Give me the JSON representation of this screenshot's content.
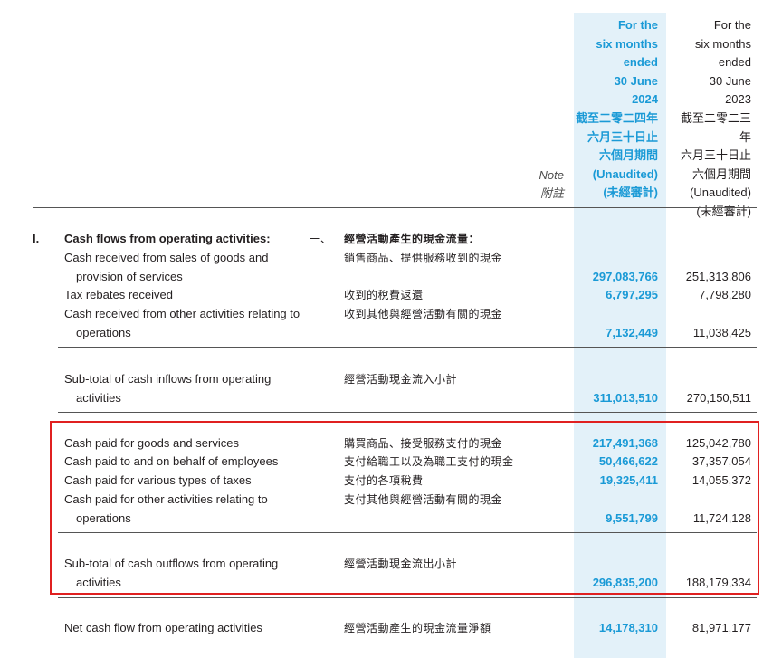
{
  "header": {
    "current_lines": [
      "For the",
      "six months",
      "ended",
      "30 June",
      "2024",
      "截至二零二四年",
      "六月三十日止",
      "六個月期間",
      "(Unaudited)",
      "(未經審計)"
    ],
    "previous_lines": [
      "For the",
      "six months",
      "ended",
      "30 June",
      "2023",
      "截至二零二三年",
      "六月三十日止",
      "六個月期間",
      "(Unaudited)",
      "(未經審計)"
    ],
    "note_en": "Note",
    "note_zh": "附註"
  },
  "section": {
    "number": "I.",
    "title_en": "Cash flows from operating activities:",
    "title_zh_prefix": "一、",
    "title_zh": "經營活動產生的現金流量："
  },
  "rows": {
    "sales": {
      "en1": "Cash received from sales of goods and",
      "en2": "provision of services",
      "zh": "銷售商品、提供服務收到的現金",
      "cur": "297,083,766",
      "prev": "251,313,806"
    },
    "tax_rebates": {
      "en1": "Tax rebates received",
      "zh": "收到的稅費返還",
      "cur": "6,797,295",
      "prev": "7,798,280"
    },
    "other_in": {
      "en1": "Cash received from other activities relating to",
      "en2": "operations",
      "zh": "收到其他與經營活動有關的現金",
      "cur": "7,132,449",
      "prev": "11,038,425"
    },
    "subtotal_in": {
      "en1": "Sub-total of cash inflows from operating",
      "en2": "activities",
      "zh": "經營活動現金流入小計",
      "cur": "311,013,510",
      "prev": "270,150,511"
    },
    "goods": {
      "en1": "Cash paid for goods and services",
      "zh": "購買商品、接受服務支付的現金",
      "cur": "217,491,368",
      "prev": "125,042,780"
    },
    "employees": {
      "en1": "Cash paid to and on behalf of employees",
      "zh": "支付給職工以及為職工支付的現金",
      "cur": "50,466,622",
      "prev": "37,357,054"
    },
    "taxes": {
      "en1": "Cash paid for various types of taxes",
      "zh": "支付的各項稅費",
      "cur": "19,325,411",
      "prev": "14,055,372"
    },
    "other_out": {
      "en1": "Cash paid for other activities relating to",
      "en2": "operations",
      "zh": "支付其他與經營活動有關的現金",
      "cur": "9,551,799",
      "prev": "11,724,128"
    },
    "subtotal_out": {
      "en1": "Sub-total of cash outflows from operating",
      "en2": "activities",
      "zh": "經營活動現金流出小計",
      "cur": "296,835,200",
      "prev": "188,179,334"
    },
    "net": {
      "en1": "Net cash flow from operating activities",
      "zh": "經營活動產生的現金流量淨額",
      "cur": "14,178,310",
      "prev": "81,971,177"
    }
  },
  "colors": {
    "accent": "#1a9ad6",
    "highlight_box": "#e02020",
    "column_shade": "#e3f1f9"
  }
}
